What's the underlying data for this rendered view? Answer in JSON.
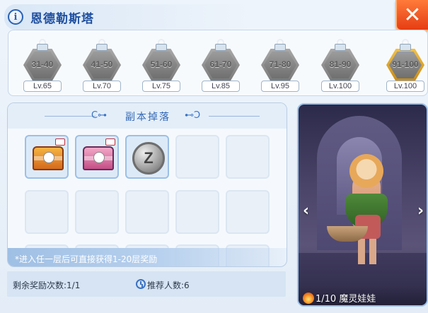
{
  "header": {
    "info_icon_glyph": "i",
    "title": "恩德勒斯塔",
    "close_glyph": "✕"
  },
  "floors": [
    {
      "range": "31-40",
      "level": "Lv.65",
      "locked": true
    },
    {
      "range": "41-50",
      "level": "Lv.70",
      "locked": true
    },
    {
      "range": "51-60",
      "level": "Lv.75",
      "locked": true
    },
    {
      "range": "61-70",
      "level": "Lv.85",
      "locked": true
    },
    {
      "range": "71-80",
      "level": "Lv.95",
      "locked": true
    },
    {
      "range": "81-90",
      "level": "Lv.100",
      "locked": true
    },
    {
      "range": "91-100",
      "level": "Lv.100",
      "locked": true,
      "highlight": "gold"
    }
  ],
  "drops": {
    "title": "副本掉落",
    "items": [
      {
        "icon": "gold-treasure-chest-icon"
      },
      {
        "icon": "pink-treasure-chest-icon"
      },
      {
        "icon": "silver-zeny-coin-icon",
        "glyph": "Z"
      }
    ],
    "note": "*进入任一层后可直接获得1-20层奖励"
  },
  "footer": {
    "remaining_label": "剩余奖励次数:1/1",
    "recommended_label": "推荐人数:6"
  },
  "boss": {
    "progress": "1/10",
    "name": "魔灵娃娃",
    "prev_glyph": "‹",
    "next_glyph": "›"
  },
  "colors": {
    "accent_blue": "#1f4fa0",
    "close_red": "#e53d14",
    "gold_highlight": "#f2c14a"
  }
}
